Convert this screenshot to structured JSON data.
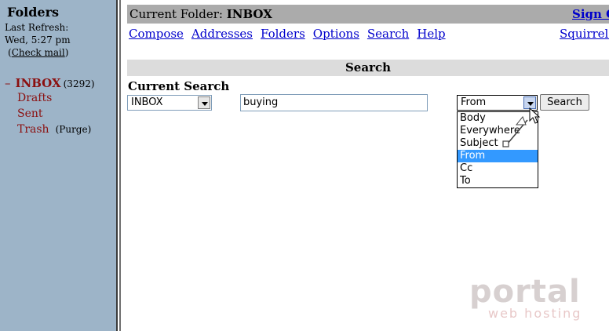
{
  "left": {
    "title": "Folders",
    "refresh_label": "Last Refresh:",
    "refresh_time": "Wed, 5:27 pm",
    "check_mail": "Check mail",
    "folders": [
      {
        "name": "INBOX",
        "count": "(3292)"
      },
      {
        "name": "Drafts"
      },
      {
        "name": "Sent"
      },
      {
        "name": "Trash",
        "action": "(Purge)"
      }
    ]
  },
  "header": {
    "current_folder_label": "Current Folder:",
    "current_folder": "INBOX",
    "sign_out": "Sign O"
  },
  "nav": {
    "compose": "Compose",
    "addresses": "Addresses",
    "folders": "Folders",
    "options": "Options",
    "search": "Search",
    "help": "Help",
    "brand": "SquirrelM"
  },
  "search": {
    "bar_title": "Search",
    "current_search_label": "Current Search",
    "folder_value": "INBOX",
    "query": "buying",
    "where_value": "From",
    "button": "Search",
    "options": [
      "Body",
      "Everywhere",
      "Subject",
      "From",
      "Cc",
      "To"
    ]
  },
  "watermark": {
    "line1": "portal",
    "line2": "web hosting"
  },
  "colors": {
    "left_pane": "#9db4c8",
    "link": "#0000cc",
    "folder": "#8b1010",
    "selected_option": "#3399ff"
  }
}
